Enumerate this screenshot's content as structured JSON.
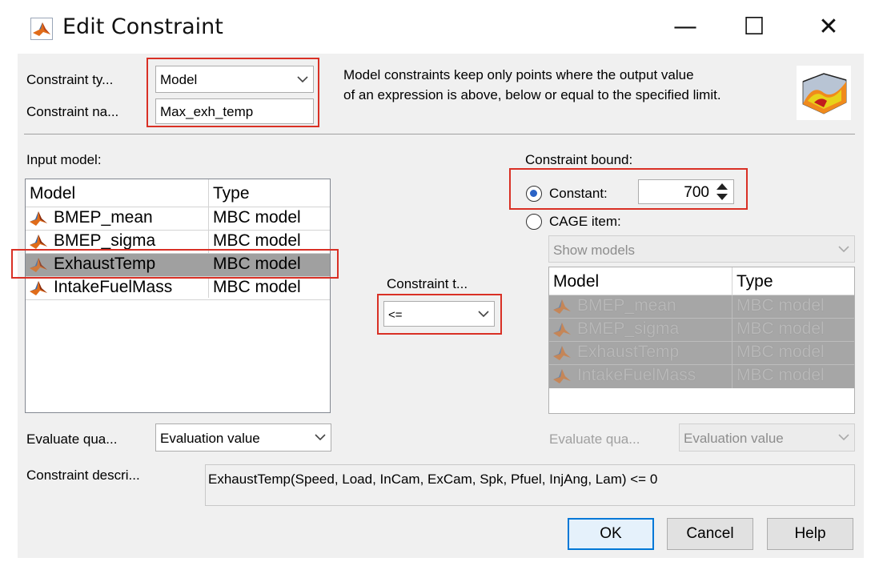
{
  "window": {
    "title": "Edit Constraint",
    "minimize": "—",
    "maximize": "☐",
    "close": "✕"
  },
  "top": {
    "type_label": "Constraint ty...",
    "type_value": "Model",
    "name_label": "Constraint na...",
    "name_value": "Max_exh_temp",
    "description_line1": "Model constraints keep only points where the output value",
    "description_line2": "of an expression is above, below or equal to the specified limit."
  },
  "input_model": {
    "label": "Input model:",
    "headers": [
      "Model",
      "Type"
    ],
    "rows": [
      {
        "name": "BMEP_mean",
        "type": "MBC model"
      },
      {
        "name": "BMEP_sigma",
        "type": "MBC model"
      },
      {
        "name": "ExhaustTemp",
        "type": "MBC model",
        "selected": true
      },
      {
        "name": "IntakeFuelMass",
        "type": "MBC model"
      }
    ]
  },
  "constraint_type": {
    "label": "Constraint t...",
    "value": "<="
  },
  "bound": {
    "label": "Constraint bound:",
    "constant_label": "Constant:",
    "constant_value": "700",
    "cage_label": "CAGE item:",
    "show_models": "Show models",
    "headers": [
      "Model",
      "Type"
    ],
    "rows": [
      {
        "name": "BMEP_mean",
        "type": "MBC model"
      },
      {
        "name": "BMEP_sigma",
        "type": "MBC model"
      },
      {
        "name": "ExhaustTemp",
        "type": "MBC model"
      },
      {
        "name": "IntakeFuelMass",
        "type": "MBC model"
      }
    ],
    "evaluate_label": "Evaluate qua...",
    "evaluate_value": "Evaluation value"
  },
  "evaluate": {
    "label": "Evaluate qua...",
    "value": "Evaluation value"
  },
  "description": {
    "label": "Constraint descri...",
    "text": "ExhaustTemp(Speed, Load, InCam, ExCam, Spk, Pfuel, InjAng, Lam) <= 0"
  },
  "buttons": {
    "ok": "OK",
    "cancel": "Cancel",
    "help": "Help"
  },
  "colors": {
    "highlight": "#d93025",
    "selected_row": "#a0a0a0",
    "disabled_table": "#a6a6a6"
  }
}
